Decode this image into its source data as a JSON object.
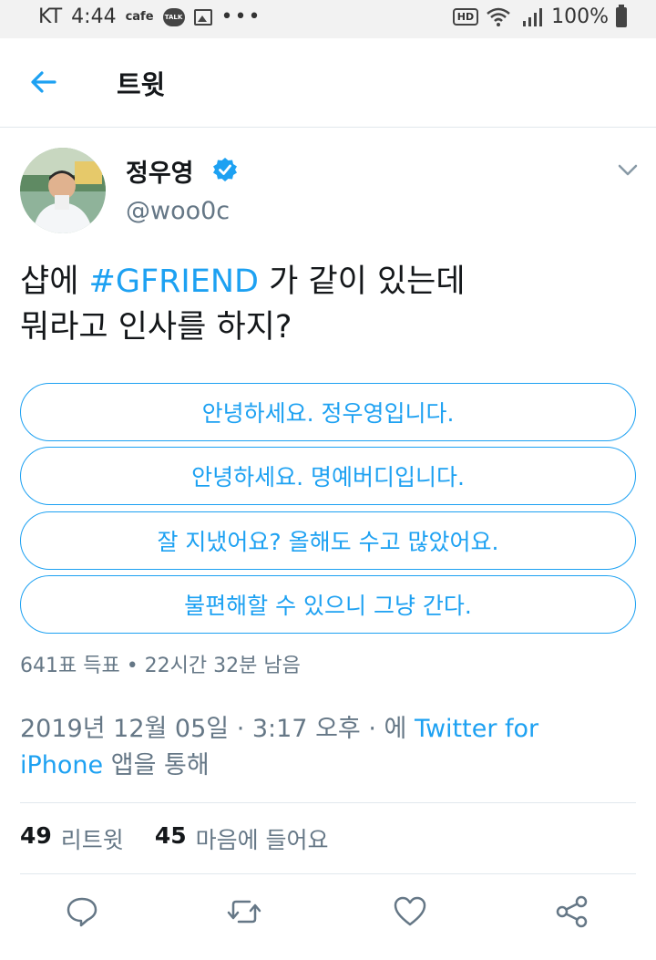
{
  "status_bar": {
    "carrier": "KT",
    "time": "4:44",
    "cafe": "cafe",
    "talk": "TALK",
    "dots": "•••",
    "hd": "HD",
    "battery": "100%"
  },
  "header": {
    "back_icon": "arrow-left-icon",
    "title": "트윗"
  },
  "tweet": {
    "author": {
      "name": "정우영",
      "handle": "@woo0c",
      "verified": true
    },
    "text_part1": "샵에 ",
    "hashtag": "#GFRIEND",
    "text_part2": " 가 같이 있는데",
    "text_line2": "뭐라고 인사를 하지?",
    "poll": {
      "options": [
        "안녕하세요. 정우영입니다.",
        "안녕하세요. 명예버디입니다.",
        "잘 지냈어요? 올해도 수고 많았어요.",
        "불편해할 수 있으니 그냥 간다."
      ],
      "meta": "641표 득표 • 22시간 32분 남음"
    },
    "timestamp": "2019년 12월 05일 · 3:17 오후 · 에 ",
    "source_link_a": "Twitter for",
    "source_link_b": "iPhone",
    "via_suffix": " 앱을 통해",
    "retweets_count": "49",
    "retweets_label": "리트윗",
    "likes_count": "45",
    "likes_label": "마음에 들어요"
  },
  "colors": {
    "accent": "#1da1f2",
    "secondary_text": "#657786",
    "primary_text": "#14171a",
    "divider": "#e1e8ed"
  },
  "actions": [
    "reply-icon",
    "retweet-icon",
    "like-icon",
    "share-icon"
  ]
}
